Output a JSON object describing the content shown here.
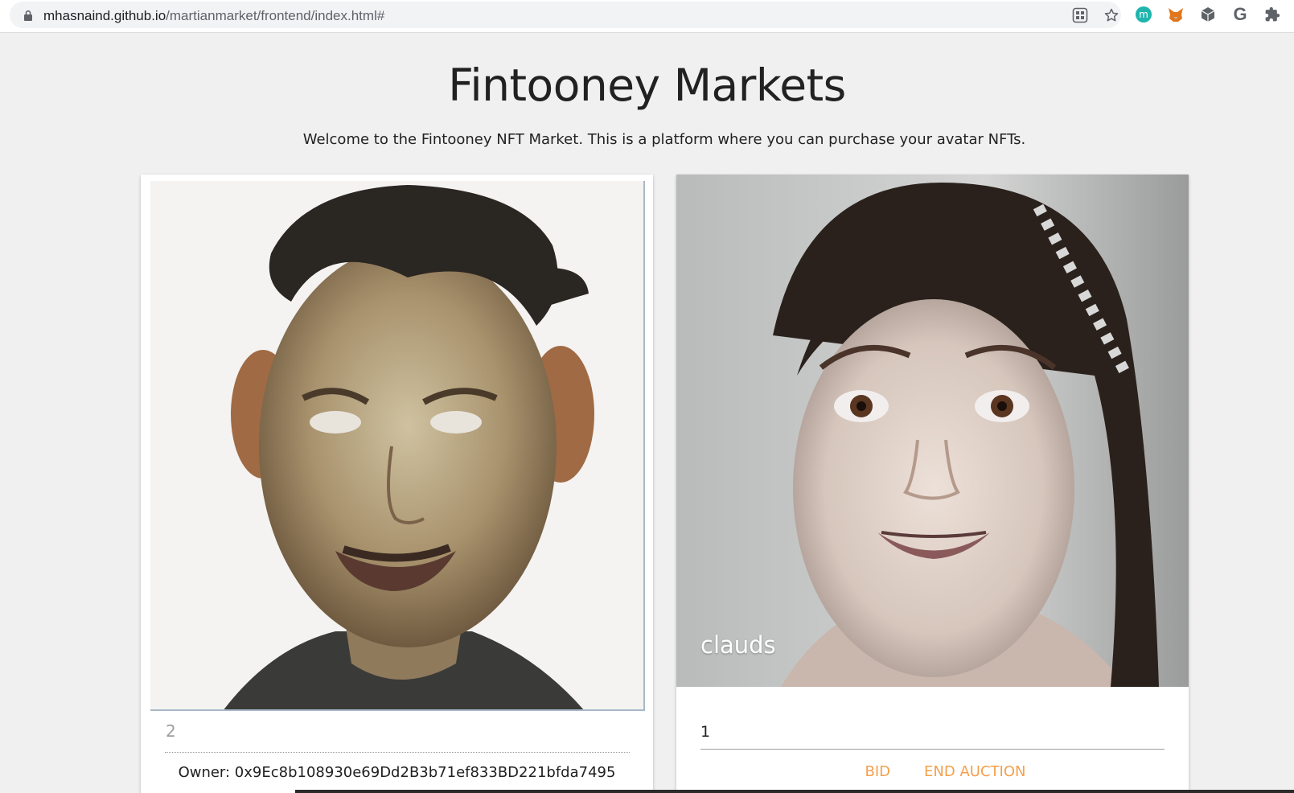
{
  "browser": {
    "url_host": "mhasnaind.github.io",
    "url_path": "/martianmarket/frontend/index.html#",
    "icons": [
      "lock-icon",
      "qr-icon",
      "star-icon",
      "m-extension-icon",
      "metamask-fox-icon",
      "cube-extension-icon",
      "grammarly-icon",
      "puzzle-icon"
    ],
    "m_ext_label": "m",
    "g_ext_label": "G"
  },
  "page": {
    "title": "Fintooney Markets",
    "subtitle": "Welcome to the Fintooney NFT Market. This is a platform where you can purchase your avatar NFTs."
  },
  "cards": [
    {
      "id_value": "2",
      "owner_text": "Owner: 0x9Ec8b108930e69Dd2B3b71ef833BD221bfda7495"
    },
    {
      "name": "clauds",
      "bid_value": "1",
      "bid_button": "BID",
      "end_auction_button": "END AUCTION"
    }
  ],
  "colors": {
    "accent": "#f5a04c",
    "page_bg": "#f0f0f0"
  }
}
